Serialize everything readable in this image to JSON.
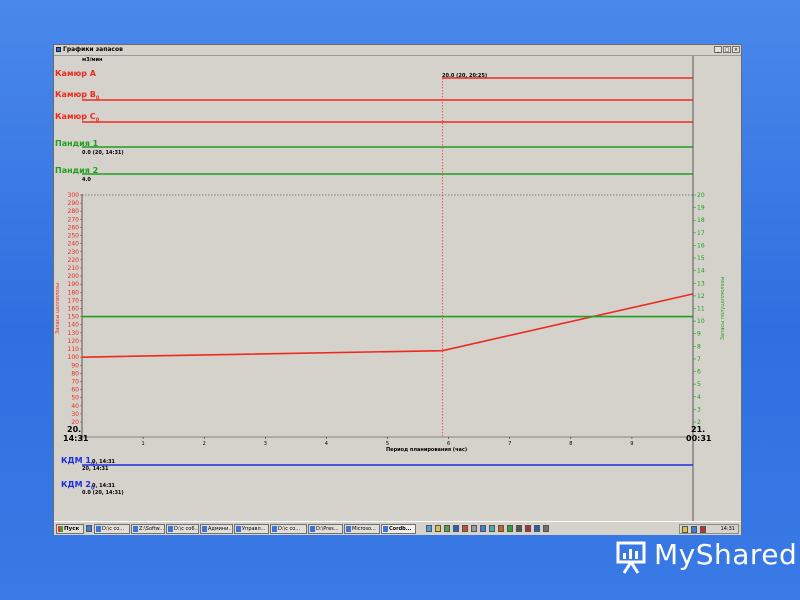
{
  "window": {
    "title": "Графики запасов",
    "controls": [
      "_",
      "□",
      "×"
    ]
  },
  "chart": {
    "unit_label": "м3/мин",
    "top_series": [
      {
        "name": "Камюр A",
        "color": "#ee2a1e",
        "value_label": "20.0 (20, 20:25)"
      },
      {
        "name": "Камюр B",
        "sub": "0",
        "color": "#ee2a1e",
        "value_label": ""
      },
      {
        "name": "Камюр C",
        "sub": "0",
        "color": "#ee2a1e",
        "value_label": ""
      },
      {
        "name": "Пандия 1",
        "color": "#1f9e1f",
        "value_label": "0.0 (20, 14:31)"
      },
      {
        "name": "Пандия 2",
        "color": "#1f9e1f",
        "value_label": "4.0"
      }
    ],
    "left_axis_title": "Запасы целлюлозы",
    "right_axis_title": "Запасы полуцеллюлозы",
    "left_ticks": [
      300,
      290,
      280,
      270,
      260,
      250,
      240,
      230,
      220,
      210,
      200,
      190,
      180,
      170,
      160,
      150,
      140,
      130,
      120,
      110,
      100,
      90,
      80,
      70,
      60,
      50,
      40,
      30,
      20
    ],
    "right_ticks": [
      20,
      19,
      18,
      17,
      16,
      15,
      14,
      13,
      12,
      11,
      10,
      9,
      8,
      7,
      6,
      5,
      4,
      3,
      2
    ],
    "x_ticks": [
      "1",
      "2",
      "3",
      "4",
      "5",
      "6",
      "7",
      "8",
      "9"
    ],
    "x_axis_title": "Период планирования (час)",
    "start_day": "20.",
    "start_time": "14:31",
    "end_day": "21.",
    "end_time": "00:31",
    "bottom_series": [
      {
        "name": "КДМ 1",
        "sub": "0",
        "color": "#1c2fe0",
        "value_label": "0, 14:31",
        "value_label2": "20, 14:31"
      },
      {
        "name": "КДМ 2",
        "sub": "0",
        "color": "#1c2fe0",
        "value_label": "0, 14:31",
        "value_label2": "0.0 (20, 14:31)"
      }
    ]
  },
  "chart_data": {
    "type": "line",
    "x_range": [
      0,
      10
    ],
    "ylim_left": [
      20,
      300
    ],
    "ylim_right": [
      2,
      20
    ],
    "xlabel": "Период планирования (час)",
    "ylabel": "Запасы целлюлозы",
    "ylabel_right": "Запасы полуцеллюлозы",
    "series": [
      {
        "name": "",
        "axis": "left",
        "color": "#ee2a1e",
        "x": [
          0,
          5.9,
          10
        ],
        "y": [
          100,
          108,
          178
        ]
      },
      {
        "name": "",
        "axis": "left",
        "color": "#1f9e1f",
        "x": [
          0,
          10
        ],
        "y": [
          150,
          150
        ]
      }
    ],
    "marker_x": 5.9
  },
  "taskbar": {
    "start_label": "Пуск",
    "buttons": [
      "D:\\c co...",
      "Z:\\Softw...",
      "D:\\c co6...",
      "Админи...",
      "Управл...",
      "D:\\c co...",
      "D:\\Pres...",
      "Microso...",
      "Cordb..."
    ],
    "active_index": 8,
    "clock": "14:31"
  },
  "branding": {
    "logo_text": "MyShared"
  }
}
